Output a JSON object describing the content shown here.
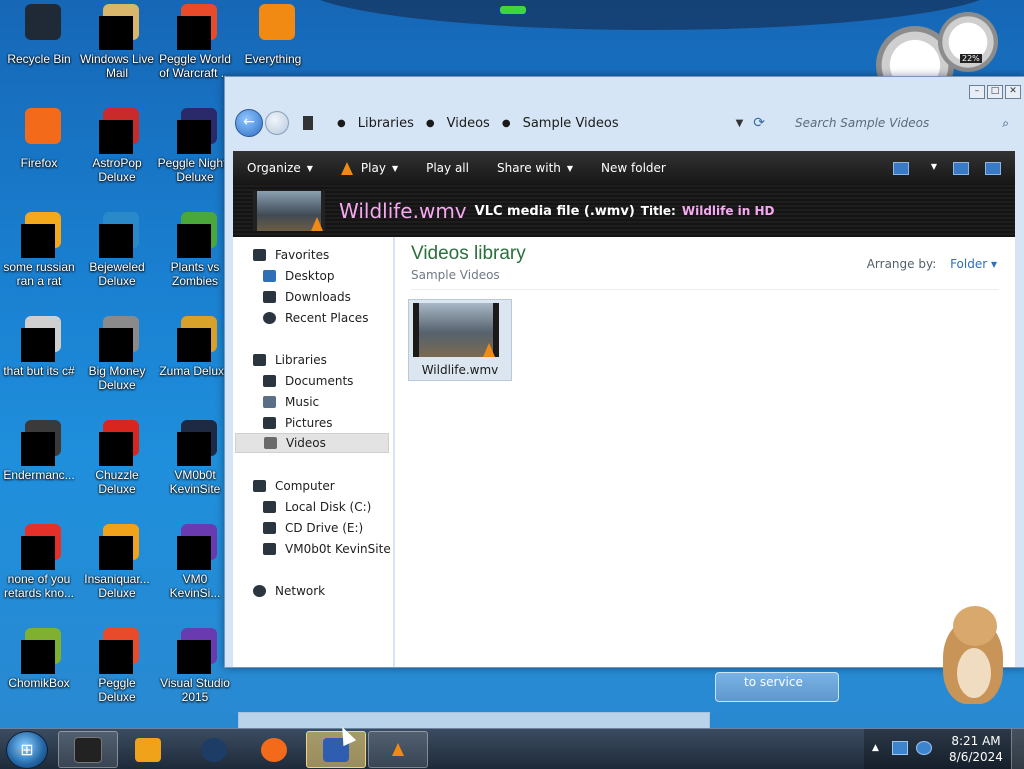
{
  "desktop": {
    "icons": [
      {
        "label": "Recycle Bin",
        "glyph": "recycle-bin-icon",
        "color": "#1f2a36"
      },
      {
        "label": "Windows Live Mail",
        "glyph": "mail-icon",
        "color": "#d9b66a"
      },
      {
        "label": "Peggle World of Warcraft ...",
        "glyph": "peggle-icon",
        "color": "#e84a2a"
      },
      {
        "label": "Everything",
        "glyph": "search-everything-icon",
        "color": "#f08a12"
      },
      {
        "label": "Firefox",
        "glyph": "firefox-icon",
        "color": "#f26a1a"
      },
      {
        "label": "AstroPop Deluxe",
        "glyph": "game-icon",
        "color": "#c92a2a"
      },
      {
        "label": "Peggle Nights Deluxe",
        "glyph": "peggle-icon",
        "color": "#2a2a6a"
      },
      {
        "label": "some russian ran a rat",
        "glyph": "app-icon",
        "color": "#f4a81c"
      },
      {
        "label": "Bejeweled Deluxe",
        "glyph": "gem-icon",
        "color": "#2a8ac9"
      },
      {
        "label": "Plants vs Zombies",
        "glyph": "plant-icon",
        "color": "#4aa83a"
      },
      {
        "label": "that but its c#",
        "glyph": "files-icon",
        "color": "#cfcfcf"
      },
      {
        "label": "Big Money Deluxe",
        "glyph": "money-icon",
        "color": "#8a8a8a"
      },
      {
        "label": "Zuma Deluxe",
        "glyph": "zuma-icon",
        "color": "#d7a12a"
      },
      {
        "label": "Endermanc...",
        "glyph": "window-icon",
        "color": "#3a3a3a"
      },
      {
        "label": "Chuzzle Deluxe",
        "glyph": "chuzzle-icon",
        "color": "#d8261f"
      },
      {
        "label": "VM0b0t KevinSite",
        "glyph": "monitor-icon",
        "color": "#1e2a44"
      },
      {
        "label": "none of you retards kno...",
        "glyph": "app-icon",
        "color": "#e5302a"
      },
      {
        "label": "Insaniquar... Deluxe",
        "glyph": "fish-icon",
        "color": "#f0a21a"
      },
      {
        "label": "VM0 KevinSi...",
        "glyph": "vs-icon",
        "color": "#6a3ab0"
      },
      {
        "label": "ChomikBox",
        "glyph": "chomikbox-icon",
        "color": "#7fb030"
      },
      {
        "label": "Peggle Deluxe",
        "glyph": "peggle-icon",
        "color": "#e84a2a"
      },
      {
        "label": "Visual Studio 2015",
        "glyph": "vs-icon",
        "color": "#6a3ab0"
      }
    ],
    "gauge_value": "22%",
    "popup_text": "to service"
  },
  "explorer": {
    "breadcrumb": [
      "Libraries",
      "Videos",
      "Sample Videos"
    ],
    "search_placeholder": "Search Sample Videos",
    "toolbar": {
      "organize": "Organize",
      "play": "Play",
      "play_all": "Play all",
      "share_with": "Share with",
      "new_folder": "New folder"
    },
    "details": {
      "file_name": "Wildlife.wmv",
      "file_type": "VLC media file (.wmv)",
      "title_label": "Title:",
      "title_value": "Wildlife in HD"
    },
    "nav": {
      "favorites": "Favorites",
      "desktop": "Desktop",
      "downloads": "Downloads",
      "recent_places": "Recent Places",
      "libraries": "Libraries",
      "documents": "Documents",
      "music": "Music",
      "pictures": "Pictures",
      "videos": "Videos",
      "computer": "Computer",
      "local_disk": "Local Disk (C:)",
      "cd_drive": "CD Drive (E:)",
      "vm_drive": "VM0b0t KevinSite",
      "network": "Network"
    },
    "content": {
      "library_title": "Videos library",
      "library_subtitle": "Sample Videos",
      "arrange_label": "Arrange by:",
      "arrange_value": "Folder",
      "items": [
        {
          "name": "Wildlife.wmv"
        }
      ]
    }
  },
  "taskbar": {
    "time": "8:21 AM",
    "date": "8/6/2024"
  }
}
